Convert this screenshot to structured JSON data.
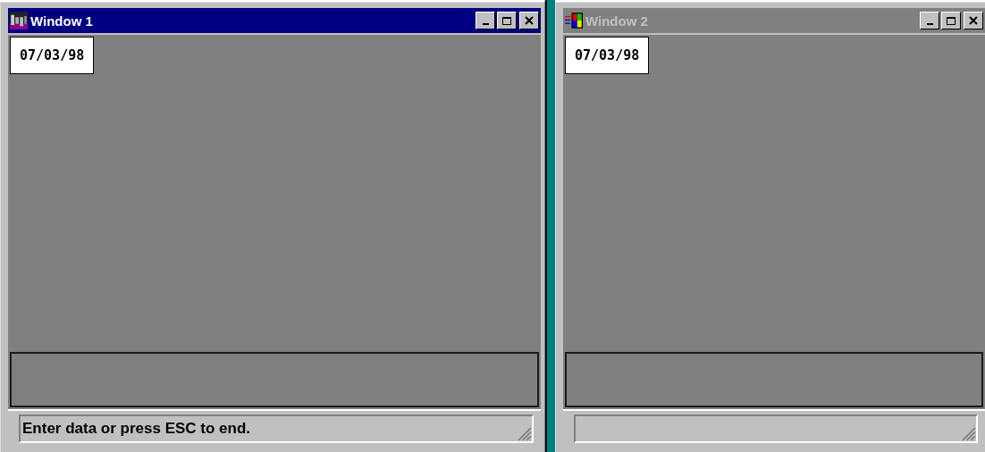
{
  "windows": [
    {
      "title": "Window 1",
      "active": true,
      "date": "07/03/98",
      "status": "Enter data or press ESC to end."
    },
    {
      "title": "Window 2",
      "active": false,
      "date": "07/03/98"
    }
  ]
}
